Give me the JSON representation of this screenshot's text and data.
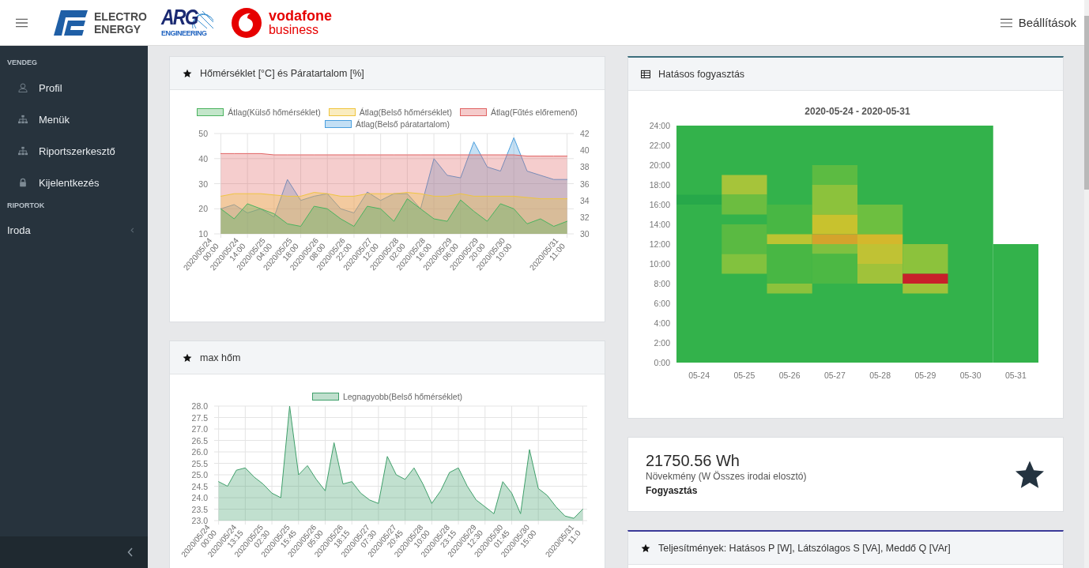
{
  "header": {
    "logos": [
      {
        "lines": [
          "ELECTRO",
          "ENERGY"
        ]
      },
      {
        "lines": [
          "ARG",
          "ENGINEERING"
        ]
      },
      {
        "lines": [
          "vodafone",
          "business"
        ]
      }
    ],
    "settings": "Beállítások"
  },
  "sidebar": {
    "sections": [
      {
        "title": "VENDEG",
        "items": [
          {
            "label": "Profil"
          },
          {
            "label": "Menük"
          },
          {
            "label": "Riportszerkesztő"
          },
          {
            "label": "Kijelentkezés"
          }
        ]
      },
      {
        "title": "RIPORTOK",
        "items": [
          {
            "label": "Iroda",
            "expanded": false
          }
        ]
      }
    ]
  },
  "left_cards": [
    {
      "title": "Hőmérséklet [°C] és Páratartalom [%]",
      "chart_data": {
        "type": "area",
        "grid": true,
        "legend": "top",
        "ylim": [
          10,
          50
        ],
        "yticks": [
          10,
          20,
          30,
          40,
          50
        ],
        "y2lim": [
          30,
          42
        ],
        "y2ticks": [
          30,
          32,
          34,
          36,
          38,
          40,
          42
        ],
        "categories": [
          "2020/05/24 00:00",
          null,
          "2020/05/24 14:00",
          null,
          "2020/05/25 04:00",
          null,
          "2020/05/25 18:00",
          null,
          "2020/05/26 08:00",
          null,
          "2020/05/26 22:00",
          null,
          "2020/05/27 12:00",
          null,
          "2020/05/28 02:00",
          null,
          "2020/05/28 16:00",
          null,
          "2020/05/29 06:00",
          null,
          "2020/05/29 20:00",
          null,
          "2020/05/30 10:00",
          null,
          null,
          null,
          "2020/05/31 11:00"
        ],
        "series": [
          {
            "name": "Átlag(Külső hőmérséklet)",
            "color": "#4bb35f",
            "values": [
              20,
              16,
              22,
              20,
              18,
              14,
              13,
              21,
              20,
              16,
              13,
              21,
              20,
              15,
              24,
              20,
              16,
              15,
              23.5,
              19,
              15,
              22,
              20,
              14,
              16,
              13,
              15
            ]
          },
          {
            "name": "Átlag(Belső hőmérséklet)",
            "color": "#efc53f",
            "values": [
              25,
              26,
              26,
              26,
              25.5,
              25,
              25,
              26.5,
              26,
              25,
              25,
              26,
              26,
              26,
              26.5,
              26,
              25,
              25,
              26,
              25,
              25,
              25,
              25,
              24.5,
              24,
              24,
              24
            ]
          },
          {
            "name": "Átlag(Fűtés előremenő)",
            "color": "#e06464",
            "values": [
              42,
              42,
              42,
              42,
              41.5,
              41.5,
              41.5,
              41.5,
              41.5,
              41.5,
              41.5,
              41.5,
              41.5,
              41.5,
              41.5,
              41.5,
              41.5,
              41.5,
              41.5,
              41.5,
              41.5,
              41.5,
              41.5,
              41,
              41,
              41,
              41
            ]
          },
          {
            "name": "Átlag(Belső páratartalom)",
            "color": "#4a9fde",
            "axis": "y2",
            "values": [
              33,
              33.5,
              32.5,
              33,
              32,
              36.5,
              34,
              34.5,
              34.8,
              33,
              32.5,
              35,
              34,
              34.8,
              34.8,
              33,
              39,
              37,
              36.7,
              41,
              38,
              37.5,
              41.5,
              37.5,
              37,
              36.5,
              36.5
            ]
          }
        ]
      }
    },
    {
      "title": "max hőm",
      "chart_data": {
        "type": "area",
        "grid": true,
        "legend": "top",
        "ylim": [
          23,
          28
        ],
        "yticks": [
          {
            "value": 23,
            "label": "23.0"
          },
          {
            "value": 23.5,
            "label": "23.5"
          },
          {
            "value": 24,
            "label": "24.0"
          },
          {
            "value": 24.5,
            "label": "24.5"
          },
          {
            "value": 25,
            "label": "25.0"
          },
          {
            "value": 25.5,
            "label": "25.5"
          },
          {
            "value": 26,
            "label": "26.0"
          },
          {
            "value": 26.5,
            "label": "26.5"
          },
          {
            "value": 27,
            "label": "27.0"
          },
          {
            "value": 27.5,
            "label": "27.5"
          },
          {
            "value": 28,
            "label": "28.0"
          }
        ],
        "categories": [
          "2020/05/24 00:00",
          null,
          null,
          "2020/05/24 13:15",
          null,
          null,
          "2020/05/25 02:30",
          null,
          null,
          "2020/05/25 15:45",
          null,
          null,
          "2020/05/26 05:00",
          null,
          null,
          "2020/05/26 18:15",
          null,
          null,
          "2020/05/27 07:30",
          null,
          null,
          "2020/05/27 20:45",
          null,
          null,
          "2020/05/28 10:00",
          null,
          null,
          "2020/05/28 23:15",
          null,
          null,
          "2020/05/29 12:30",
          null,
          null,
          "2020/05/30 01:45",
          null,
          null,
          "2020/05/30 15:00",
          null,
          null,
          null,
          null,
          "2020/05/31 11:0"
        ],
        "series": [
          {
            "name": "Legnagyobb(Belső hőmérséklet)",
            "color": "#3f9f6a",
            "values": [
              24.7,
              24.5,
              25.2,
              25.3,
              24.9,
              24.6,
              24.2,
              24.0,
              28.0,
              25.0,
              25.4,
              24.8,
              24.3,
              26.4,
              24.6,
              24.7,
              24.2,
              23.9,
              23.75,
              25.8,
              25.0,
              24.8,
              25.3,
              24.6,
              23.75,
              24.3,
              25.1,
              25.3,
              24.5,
              23.9,
              23.6,
              23.3,
              24.7,
              24.2,
              23.3,
              26.1,
              24.4,
              24.1,
              23.6,
              23.2,
              23.1,
              23.5
            ]
          }
        ]
      }
    }
  ],
  "heatmap_card": {
    "title": "Hatásos fogyasztás",
    "chart_title": "2020-05-24 - 2020-05-31",
    "yticks": [
      "24:00",
      "22:00",
      "20:00",
      "18:00",
      "16:00",
      "14:00",
      "12:00",
      "10:00",
      "8:00",
      "6:00",
      "4:00",
      "2:00",
      "0:00"
    ],
    "xticks": [
      "05-24",
      "05-25",
      "05-26",
      "05-27",
      "05-28",
      "05-29",
      "05-30",
      "05-31"
    ]
  },
  "kpi_card": {
    "value": "21750.56 Wh",
    "subtitle": "Növekmény (W Összes irodai elosztó)",
    "label": "Fogyasztás"
  },
  "power_card": {
    "title": "Teljesítmények: Hatásos P [W], Látszólagos S [VA], Meddő Q [VAr]"
  }
}
